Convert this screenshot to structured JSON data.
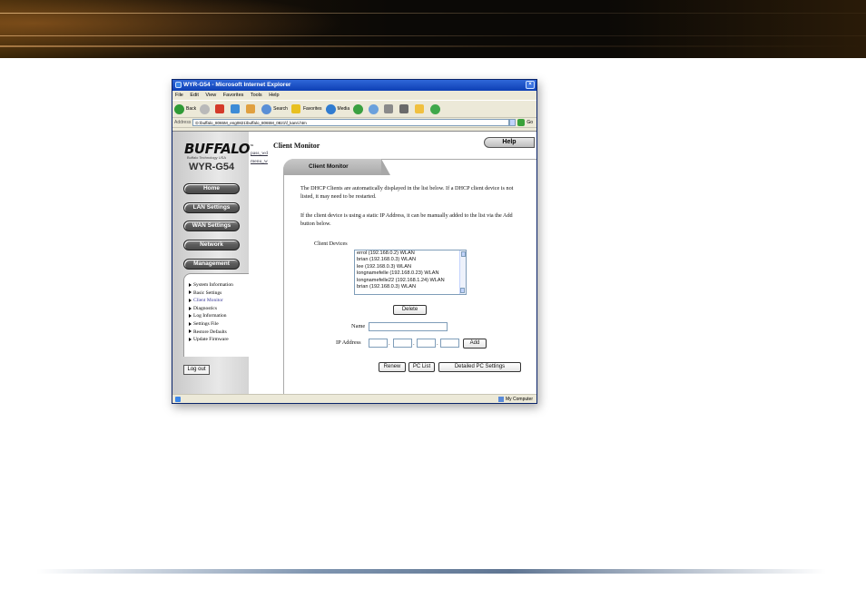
{
  "browser": {
    "title": "WYR-G54 - Microsoft Internet Explorer",
    "menu": [
      "File",
      "Edit",
      "View",
      "Favorites",
      "Tools",
      "Help"
    ],
    "toolbar": {
      "back": "Back",
      "search": "Search",
      "favorites": "Favorites",
      "media": "Media"
    },
    "address_label": "Address",
    "address": "D:\\buffalo_8065M_eng0821\\buffalo_8065M_0821\\f_kanri.htm",
    "go": "Go",
    "status_zone": "My Computer"
  },
  "sidebar": {
    "logo": "BUFFALO",
    "logo_sub": "Buffalo Technology USA",
    "model": "WYR-G54",
    "nav": [
      "Home",
      "LAN Settings",
      "WAN Settings",
      "Network",
      "Management"
    ],
    "submenu": [
      {
        "label": "System Information",
        "active": false
      },
      {
        "label": "Basic Settings",
        "active": false
      },
      {
        "label": "Client Monitor",
        "active": true
      },
      {
        "label": "Diagnostics",
        "active": false
      },
      {
        "label": "Log Information",
        "active": false
      },
      {
        "label": "Settings File",
        "active": false
      },
      {
        "label": "Restore Defaults",
        "active": false
      },
      {
        "label": "Update Firmware",
        "active": false
      }
    ],
    "logout": "Log out"
  },
  "links": [
    "pass_wd",
    "menu_w"
  ],
  "page": {
    "title": "Client Monitor",
    "help": "Help",
    "tab": "Client Monitor",
    "para1": "The DHCP Clients are automatically displayed in the list below. If a DHCP client device is not listed, it may need to be restarted.",
    "para2": "If the client device is using a static IP Address, it can be manually added to the list via the Add button below.",
    "client_devices_label": "Client Devices",
    "clients": [
      "errol (192.168.0.2) WLAN",
      "brian (192.168.0.3) WLAN",
      "lee (192.168.0.3) WLAN",
      "longnamefelle (192.168.0.23) WLAN",
      "longnamefelle22 (192.168.1.24) WLAN",
      "brian (192.168.0.3) WLAN"
    ],
    "delete": "Delete",
    "name_label": "Name",
    "ip_label": "IP Address",
    "add": "Add",
    "renew": "Renew",
    "pc_list": "PC List",
    "detailed": "Detailed PC Settings"
  }
}
